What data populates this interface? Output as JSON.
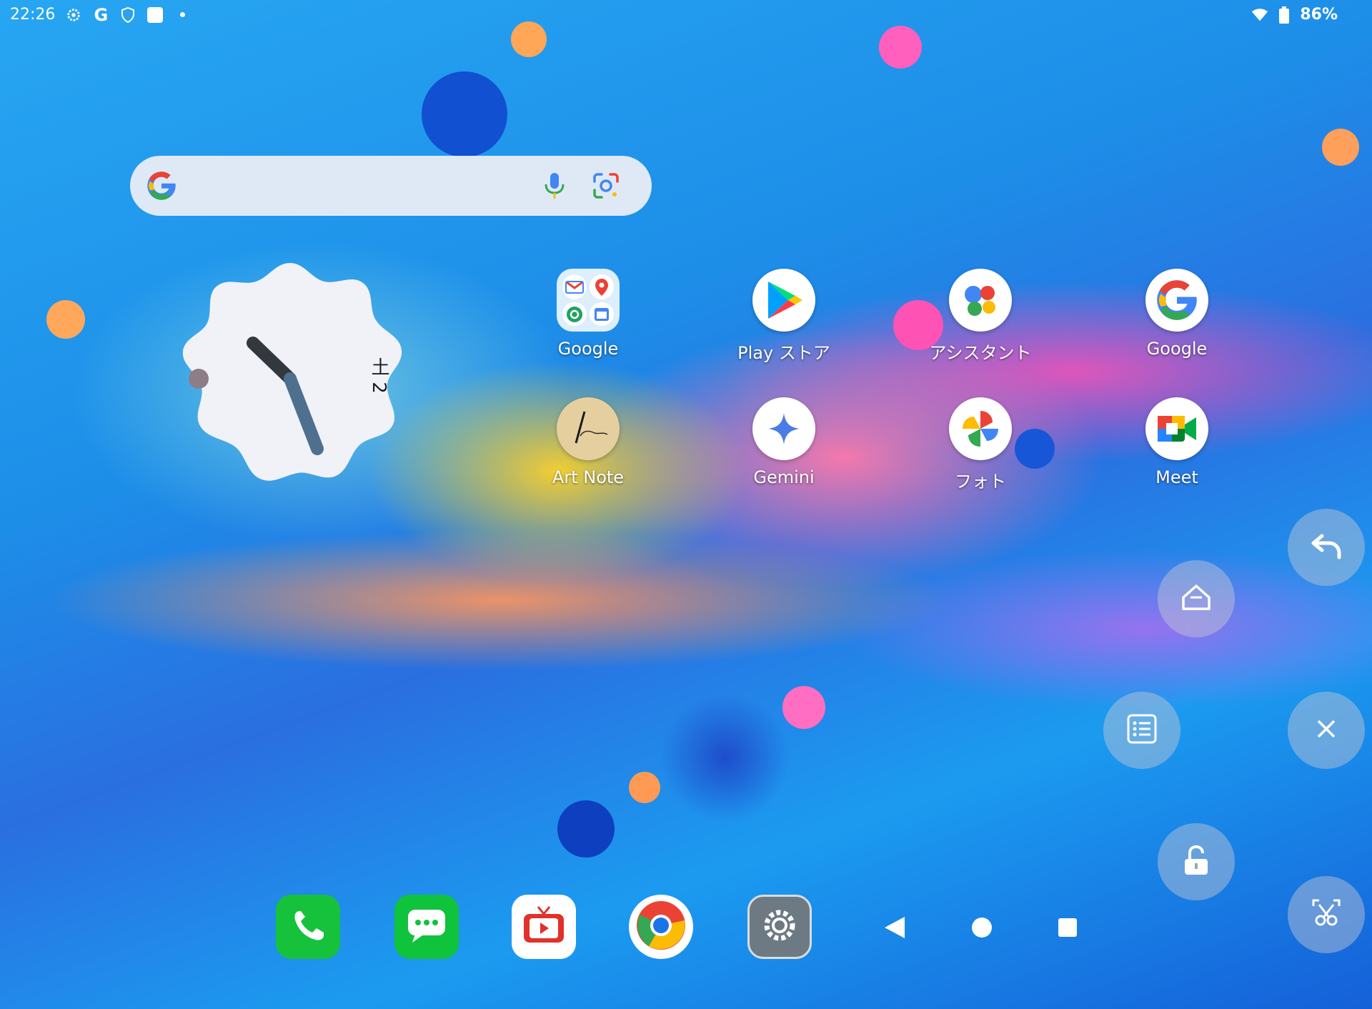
{
  "status_bar": {
    "time": "22:26",
    "battery": "86%",
    "icons_left": [
      "settings-icon",
      "google-icon",
      "shield-icon",
      "square-icon",
      "dot-icon"
    ],
    "icons_right": [
      "wifi-icon",
      "battery-icon"
    ]
  },
  "search": {
    "icons": [
      "google-g-icon",
      "mic-icon",
      "lens-icon"
    ]
  },
  "clock": {
    "date_label": "土 2"
  },
  "apps": [
    {
      "label": "Google",
      "icon": "folder-icon"
    },
    {
      "label": "Play ストア",
      "icon": "play-store-icon"
    },
    {
      "label": "アシスタント",
      "icon": "assistant-icon"
    },
    {
      "label": "Google",
      "icon": "google-icon"
    },
    {
      "label": "Art Note",
      "icon": "art-note-icon"
    },
    {
      "label": "Gemini",
      "icon": "gemini-icon"
    },
    {
      "label": "フォト",
      "icon": "photos-icon"
    },
    {
      "label": "Meet",
      "icon": "meet-icon"
    }
  ],
  "dock": [
    "phone-icon",
    "messages-icon",
    "tv-icon",
    "chrome-icon",
    "settings-icon"
  ],
  "nav": [
    "back-icon",
    "home-icon",
    "recents-icon"
  ],
  "floating_menu": [
    "back-arrow-icon",
    "home-icon",
    "list-icon",
    "close-icon",
    "lock-icon",
    "screenshot-icon"
  ],
  "colors": {
    "accent_blue": "#1a73e8",
    "google_red": "#ea4335",
    "google_yellow": "#fbbc05",
    "google_green": "#34a853"
  }
}
